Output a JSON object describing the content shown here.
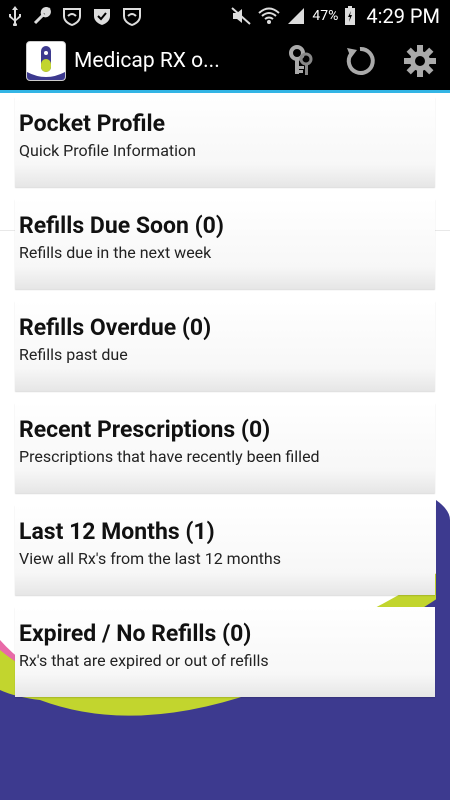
{
  "status_bar": {
    "battery_percent": "47%",
    "time": "4:29 PM"
  },
  "action_bar": {
    "title": "Medicap RX o...",
    "accent_color": "#33b5e5"
  },
  "menu": [
    {
      "title": "Pocket Profile",
      "subtitle": "Quick Profile Information"
    },
    {
      "title": "Refills Due Soon (0)",
      "subtitle": "Refills due in the next week"
    },
    {
      "title": "Refills Overdue (0)",
      "subtitle": "Refills past due"
    },
    {
      "title": "Recent Prescriptions (0)",
      "subtitle": "Prescriptions that have recently been filled"
    },
    {
      "title": "Last 12 Months (1)",
      "subtitle": "View all Rx's from the last 12 months"
    },
    {
      "title": "Expired / No Refills (0)",
      "subtitle": "Rx's that are expired or out of refills"
    }
  ],
  "theme": {
    "purple": "#3d3a8f",
    "lime": "#c2d52e",
    "pink": "#e86aa8"
  }
}
